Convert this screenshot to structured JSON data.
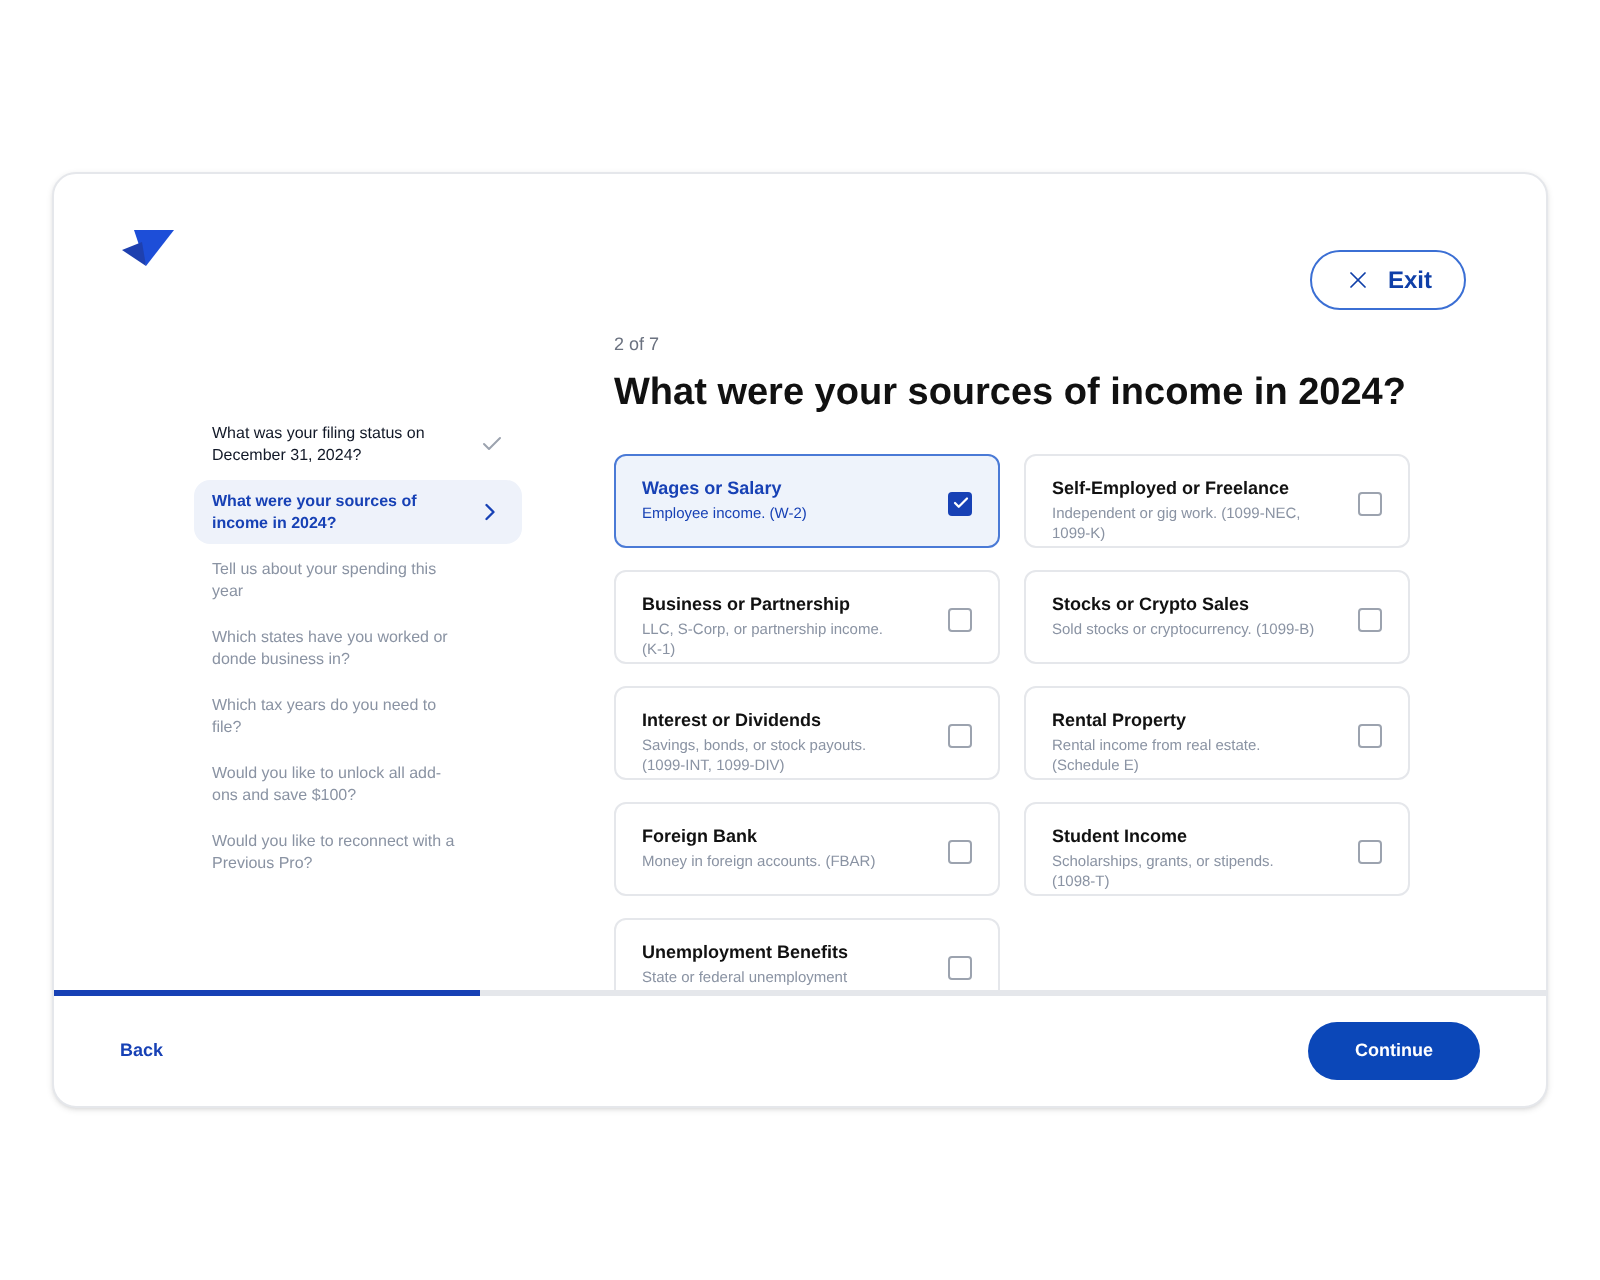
{
  "exit_button": {
    "label": "Exit"
  },
  "steps": [
    {
      "label": "What was your filing status on December 31, 2024?",
      "done": true,
      "selected": false
    },
    {
      "label": "What were your sources of income in 2024?",
      "done": false,
      "selected": true
    },
    {
      "label": "Tell us about your spending this year",
      "done": false,
      "selected": false
    },
    {
      "label": "Which states have you worked or donde business in?",
      "done": false,
      "selected": false
    },
    {
      "label": "Which tax years do you need to file?",
      "done": false,
      "selected": false
    },
    {
      "label": "Would you like to unlock all add-ons and save $100?",
      "done": false,
      "selected": false
    },
    {
      "label": "Would you like to reconnect with a Previous Pro?",
      "done": false,
      "selected": false
    }
  ],
  "step_counter": "2 of 7",
  "question": "What were your sources of income in 2024?",
  "options": [
    {
      "title": "Wages or Salary",
      "description": "Employee income. (W-2)",
      "checked": true
    },
    {
      "title": "Self-Employed or Freelance",
      "description": "Independent or gig work. (1099-NEC, 1099-K)",
      "checked": false
    },
    {
      "title": "Business or Partnership",
      "description": "LLC, S-Corp, or partnership income. (K-1)",
      "checked": false
    },
    {
      "title": "Stocks or Crypto Sales",
      "description": "Sold stocks or cryptocurrency. (1099-B)",
      "checked": false
    },
    {
      "title": "Interest or Dividends",
      "description": "Savings, bonds, or stock payouts. (1099-INT, 1099-DIV)",
      "checked": false
    },
    {
      "title": "Rental Property",
      "description": "Rental income from real estate. (Schedule E)",
      "checked": false
    },
    {
      "title": "Foreign Bank",
      "description": "Money in foreign accounts. (FBAR)",
      "checked": false
    },
    {
      "title": "Student Income",
      "description": "Scholarships, grants, or stipends. (1098-T)",
      "checked": false
    },
    {
      "title": "Unemployment Benefits",
      "description": "State or federal unemployment",
      "checked": false
    }
  ],
  "progress": {
    "level": 0.285
  },
  "back_link": "Back",
  "continue_button": "Continue"
}
